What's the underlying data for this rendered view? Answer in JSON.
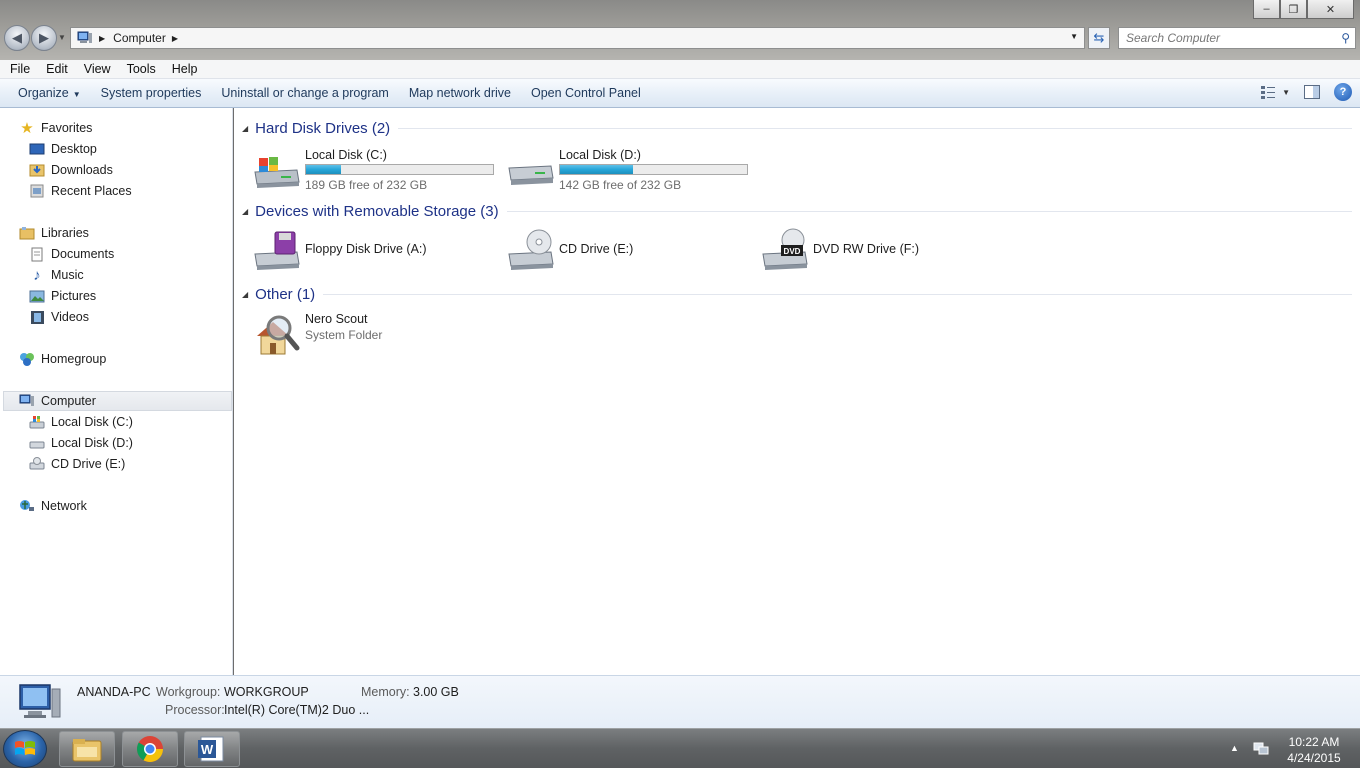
{
  "window": {
    "address": {
      "crumb": "Computer"
    },
    "search": {
      "placeholder": "Search Computer"
    },
    "caption": {
      "minimize": "–",
      "restore": "❐",
      "close": "✕"
    }
  },
  "menubar": [
    "File",
    "Edit",
    "View",
    "Tools",
    "Help"
  ],
  "commandbar": {
    "organize": "Organize",
    "system_properties": "System properties",
    "uninstall": "Uninstall or change a program",
    "map_drive": "Map network drive",
    "control_panel": "Open Control Panel"
  },
  "nav": {
    "favorites": "Favorites",
    "desktop": "Desktop",
    "downloads": "Downloads",
    "recent": "Recent Places",
    "libraries": "Libraries",
    "documents": "Documents",
    "music": "Music",
    "pictures": "Pictures",
    "videos": "Videos",
    "homegroup": "Homegroup",
    "computer": "Computer",
    "disk_c": "Local Disk (C:)",
    "disk_d": "Local Disk (D:)",
    "cd_e": "CD Drive (E:)",
    "network": "Network"
  },
  "groups": {
    "hdd": {
      "title": "Hard Disk Drives (2)",
      "items": [
        {
          "name": "Local Disk (C:)",
          "free_text": "189 GB free of 232 GB",
          "used_fraction": 0.185
        },
        {
          "name": "Local Disk (D:)",
          "free_text": "142 GB free of 232 GB",
          "used_fraction": 0.388
        }
      ]
    },
    "removable": {
      "title": "Devices with Removable Storage (3)",
      "items": [
        {
          "name": "Floppy Disk Drive (A:)"
        },
        {
          "name": "CD Drive (E:)"
        },
        {
          "name": "DVD RW Drive (F:)"
        }
      ]
    },
    "other": {
      "title": "Other (1)",
      "items": [
        {
          "name": "Nero Scout",
          "sub": "System Folder"
        }
      ]
    }
  },
  "details": {
    "pc_name": "ANANDA-PC",
    "workgroup_label": "Workgroup:",
    "workgroup": "WORKGROUP",
    "memory_label": "Memory:",
    "memory": "3.00 GB",
    "processor_label": "Processor:",
    "processor": "Intel(R) Core(TM)2 Duo ..."
  },
  "taskbar": {
    "time": "10:22 AM",
    "date": "4/24/2015"
  }
}
